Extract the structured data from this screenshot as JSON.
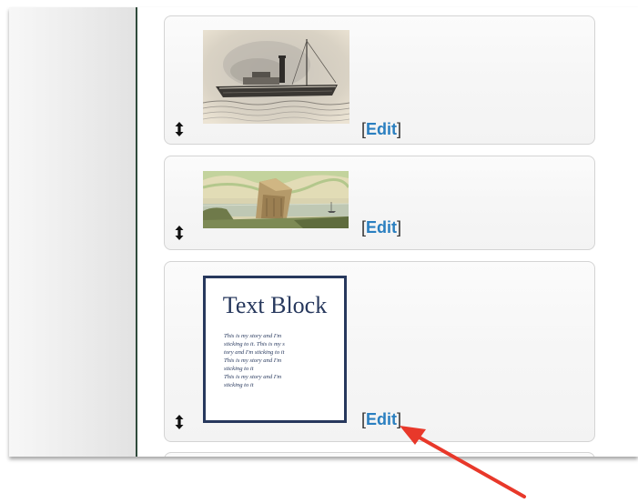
{
  "cards": [
    {
      "type": "image",
      "image_icon": "steamship-engraving",
      "edit": {
        "open": "[",
        "label": "Edit",
        "close": "]"
      }
    },
    {
      "type": "image",
      "image_icon": "harbor-ruin-painting",
      "edit": {
        "open": "[",
        "label": "Edit",
        "close": "]"
      }
    },
    {
      "type": "text-block",
      "text_block": {
        "title": "Text Block",
        "lines": [
          "This is my story and I'm",
          "sticking to it. This is my s",
          "tory and I'm  sticking to it",
          "This is my story and I'm",
          "sticking to it",
          "This is my story and I'm",
          "sticking to it"
        ]
      },
      "edit": {
        "open": "[",
        "label": "Edit",
        "close": "]"
      }
    }
  ],
  "colors": {
    "edit_link": "#2a7fc0",
    "annotation_arrow": "#e8382a",
    "text_block_border": "#27385d"
  },
  "icons": {
    "drag_handle": "up-down-arrow-icon"
  }
}
